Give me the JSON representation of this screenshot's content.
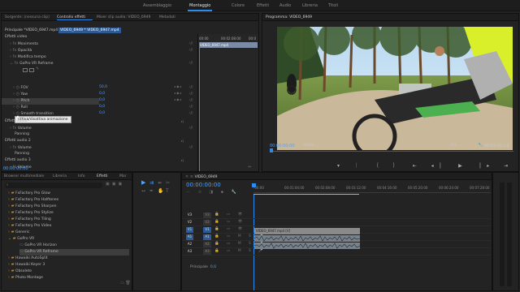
{
  "workspaces": [
    "Assemblaggio",
    "Montaggio",
    "Colore",
    "Effetti",
    "Audio",
    "Libreria",
    "Titoli"
  ],
  "top_tabs": {
    "source": "Sorgente: (nessuna clip)",
    "effects": "Controllo effetti",
    "mixer": "Mixer clip audio: VIDEO_6949",
    "metadata": "Metadati"
  },
  "effects_controls": {
    "header_clip": "Principale *VIDEO_6947.mp4",
    "header_seq": "VIDEO_6949 * VIDEO_6947.mp4",
    "timeline_ticks": [
      "00:00",
      "00:02:08:00",
      "00:0"
    ],
    "clip_label": "VIDEO_6947.mp4",
    "section_video": "Effetti video",
    "rows": [
      {
        "label": "Movimento",
        "indent": 1
      },
      {
        "label": "Opacità",
        "indent": 1
      },
      {
        "label": "Modifica tempo",
        "indent": 1
      },
      {
        "label": "GoPro VR Reframe",
        "indent": 1
      }
    ],
    "params": [
      {
        "label": "FOV",
        "value": "50,0"
      },
      {
        "label": "Yaw",
        "value": "0,0"
      },
      {
        "label": "Pitch",
        "value": "0,0"
      },
      {
        "label": "Roll",
        "value": "0,0"
      },
      {
        "label": "Smooth transition",
        "value": "0,0"
      }
    ],
    "tooltip": "Attiva/disattiva animazione",
    "audio1_label": "Effetti audio",
    "volume": "Volume",
    "panning": "Panning",
    "audio2_label": "Effetti audio 2",
    "audio3_label": "Effetti audio 3",
    "time": "00:00:00:00"
  },
  "program": {
    "title": "Programma: VIDEO_6949",
    "timecode": "00:00:00:00",
    "fit": "Adatta",
    "ratio": "1/4",
    "duration": "00:04:02:19"
  },
  "project": {
    "tabs": [
      "Browser multimediale",
      "Libreria",
      "Info",
      "Effetti",
      "Mar"
    ],
    "search_placeholder": "",
    "items": [
      {
        "label": "FxFactory Pro Glow",
        "level": 1
      },
      {
        "label": "FxFactory Pro Halftones",
        "level": 1
      },
      {
        "label": "FxFactory Pro Sharpen",
        "level": 1
      },
      {
        "label": "FxFactory Pro Stylize",
        "level": 1
      },
      {
        "label": "FxFactory Pro Tiling",
        "level": 1
      },
      {
        "label": "FxFactory Pro Video",
        "level": 1
      },
      {
        "label": "Generic",
        "level": 1
      },
      {
        "label": "GoPro VR",
        "level": 1
      },
      {
        "label": "GoPro VR Horizon",
        "level": 2
      },
      {
        "label": "GoPro VR Reframe",
        "level": 2
      },
      {
        "label": "Hawaiki AutoSplit",
        "level": 1
      },
      {
        "label": "Hawaiki Keyer 3",
        "level": 1
      },
      {
        "label": "Obsolete",
        "level": 1
      },
      {
        "label": "Photo Montage",
        "level": 1
      }
    ]
  },
  "timeline": {
    "title": "VIDEO_6949",
    "timecode": "00:00:00:00",
    "ruler": [
      ":00:00",
      "00:01:04:00",
      "00:02:08:00",
      "00:03:12:00",
      "00:04:16:00",
      "00:05:20:00",
      "00:06:24:00",
      "00:07:28:00"
    ],
    "tracks": [
      "V3",
      "V2",
      "V1",
      "A1",
      "A2",
      "A3"
    ],
    "target_v": "V1",
    "target_a": "A1",
    "video_clip": "VIDEO_6947.mp4 [V]",
    "master": "Principale",
    "master_val": "0,0"
  },
  "colors": {
    "accent": "#2d8ceb",
    "timecode": "#4da3ff",
    "clip_video": "#8a8a8a",
    "clip_audio": "#8a8a8a"
  }
}
